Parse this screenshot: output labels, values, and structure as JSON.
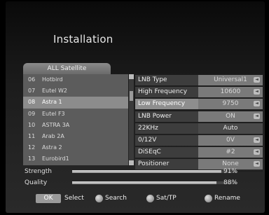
{
  "title": "Installation",
  "satellite_tab": "ALL Satellite",
  "satellites": [
    {
      "num": "06",
      "name": "Hotbird",
      "selected": false
    },
    {
      "num": "07",
      "name": "Eutel W2",
      "selected": false
    },
    {
      "num": "08",
      "name": "Astra 1",
      "selected": true
    },
    {
      "num": "09",
      "name": "Eutel F3",
      "selected": false
    },
    {
      "num": "10",
      "name": "ASTRA 3A",
      "selected": false
    },
    {
      "num": "11",
      "name": "Arab 2A",
      "selected": false
    },
    {
      "num": "12",
      "name": "Astra 2",
      "selected": false
    },
    {
      "num": "13",
      "name": "Eurobird1",
      "selected": false
    }
  ],
  "params": [
    {
      "label": "LNB Type",
      "value": "Universal1",
      "arrow": true,
      "highlight": false
    },
    {
      "label": "High Frequency",
      "value": "10600",
      "arrow": true,
      "highlight": false
    },
    {
      "label": "Low Frequency",
      "value": "9750",
      "arrow": true,
      "highlight": true
    },
    {
      "label": "LNB Power",
      "value": "ON",
      "arrow": true,
      "highlight": false
    },
    {
      "label": "22KHz",
      "value": "Auto",
      "arrow": false,
      "highlight": false
    },
    {
      "label": "0/12V",
      "value": "0V",
      "arrow": true,
      "highlight": false
    },
    {
      "label": "DiSEqC",
      "value": "#2",
      "arrow": true,
      "highlight": false
    },
    {
      "label": "Positioner",
      "value": "None",
      "arrow": true,
      "highlight": false
    }
  ],
  "strength": {
    "label": "Strength",
    "percent_text": "91%",
    "level": 0.91
  },
  "quality": {
    "label": "Quality",
    "percent_text": "88%",
    "level": 0.88
  },
  "footer": {
    "ok_label": "OK",
    "select_label": "Select",
    "search_label": "Search",
    "sattp_label": "Sat/TP",
    "rename_label": "Rename"
  }
}
